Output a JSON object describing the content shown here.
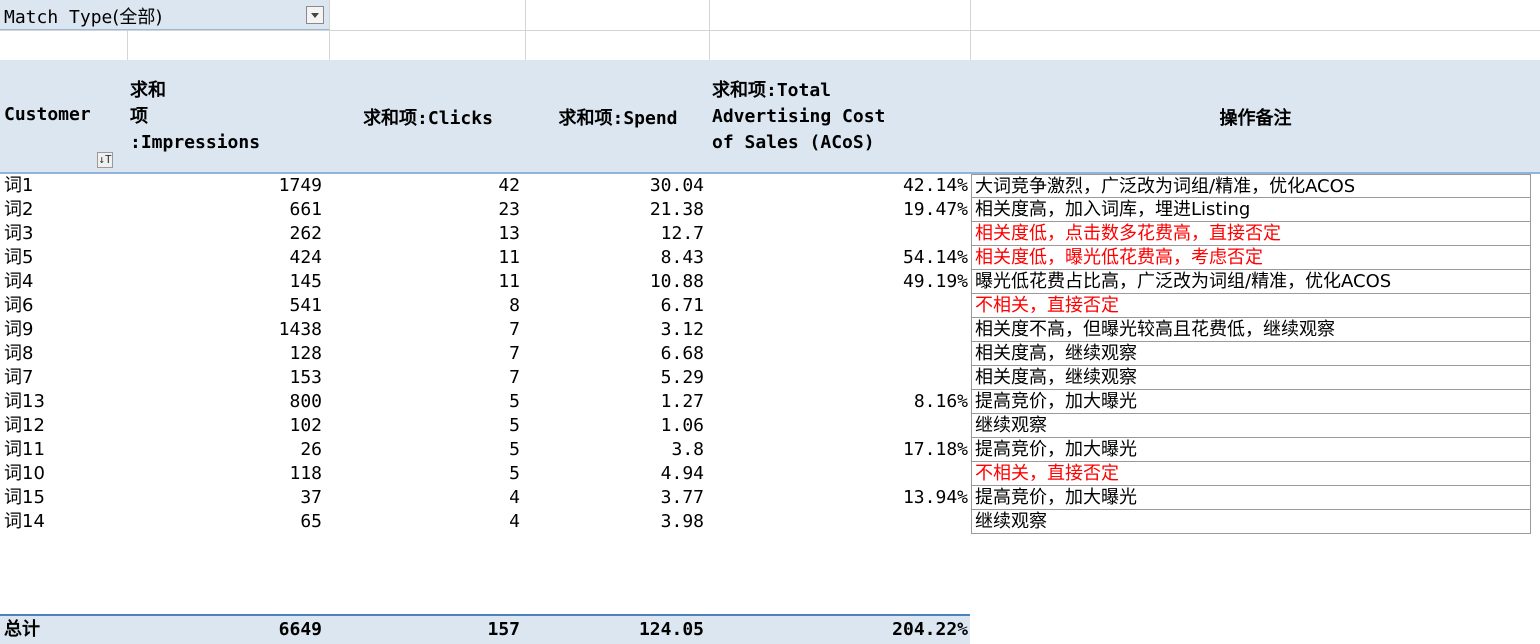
{
  "filter": {
    "label": "Match Type",
    "value": "(全部)"
  },
  "headers": {
    "customer": "Customer",
    "impressions": [
      "求和",
      "项",
      ":Impressions"
    ],
    "clicks": "求和项:Clicks",
    "spend": "求和项:Spend",
    "acos": [
      "求和项:Total",
      "Advertising Cost",
      "of Sales (ACoS)"
    ],
    "notes": "操作备注"
  },
  "rows": [
    {
      "term": "词1",
      "impressions": "1749",
      "clicks": "42",
      "spend": "30.04",
      "acos": "42.14%",
      "note": "大词竞争激烈，广泛改为词组/精准，优化ACOS",
      "note_red": false
    },
    {
      "term": "词2",
      "impressions": "661",
      "clicks": "23",
      "spend": "21.38",
      "acos": "19.47%",
      "note": "相关度高，加入词库，埋进Listing",
      "note_red": false
    },
    {
      "term": "词3",
      "impressions": "262",
      "clicks": "13",
      "spend": "12.7",
      "acos": "",
      "note": "相关度低，点击数多花费高，直接否定",
      "note_red": true
    },
    {
      "term": "词5",
      "impressions": "424",
      "clicks": "11",
      "spend": "8.43",
      "acos": "54.14%",
      "note": "相关度低，曝光低花费高，考虑否定",
      "note_red": true
    },
    {
      "term": "词4",
      "impressions": "145",
      "clicks": "11",
      "spend": "10.88",
      "acos": "49.19%",
      "note": "曝光低花费占比高，广泛改为词组/精准，优化ACOS",
      "note_red": false
    },
    {
      "term": "词6",
      "impressions": "541",
      "clicks": "8",
      "spend": "6.71",
      "acos": "",
      "note": "不相关，直接否定",
      "note_red": true
    },
    {
      "term": "词9",
      "impressions": "1438",
      "clicks": "7",
      "spend": "3.12",
      "acos": "",
      "note": "相关度不高，但曝光较高且花费低，继续观察",
      "note_red": false
    },
    {
      "term": "词8",
      "impressions": "128",
      "clicks": "7",
      "spend": "6.68",
      "acos": "",
      "note": "相关度高，继续观察",
      "note_red": false
    },
    {
      "term": "词7",
      "impressions": "153",
      "clicks": "7",
      "spend": "5.29",
      "acos": "",
      "note": "相关度高，继续观察",
      "note_red": false
    },
    {
      "term": "词13",
      "impressions": "800",
      "clicks": "5",
      "spend": "1.27",
      "acos": "8.16%",
      "note": "提高竞价，加大曝光",
      "note_red": false
    },
    {
      "term": "词12",
      "impressions": "102",
      "clicks": "5",
      "spend": "1.06",
      "acos": "",
      "note": "继续观察",
      "note_red": false
    },
    {
      "term": "词11",
      "impressions": "26",
      "clicks": "5",
      "spend": "3.8",
      "acos": "17.18%",
      "note": "提高竞价，加大曝光",
      "note_red": false
    },
    {
      "term": "词10",
      "impressions": "118",
      "clicks": "5",
      "spend": "4.94",
      "acos": "",
      "note": "不相关，直接否定",
      "note_red": true
    },
    {
      "term": "词15",
      "impressions": "37",
      "clicks": "4",
      "spend": "3.77",
      "acos": "13.94%",
      "note": "提高竞价，加大曝光",
      "note_red": false
    },
    {
      "term": "词14",
      "impressions": "65",
      "clicks": "4",
      "spend": "3.98",
      "acos": "",
      "note": "继续观察",
      "note_red": false
    }
  ],
  "total": {
    "label": "总计",
    "impressions": "6649",
    "clicks": "157",
    "spend": "124.05",
    "acos": "204.22%"
  },
  "colors": {
    "header_bg": "#dce6f1",
    "border_blue": "#4f81bd",
    "note_red": "#ff0000"
  }
}
